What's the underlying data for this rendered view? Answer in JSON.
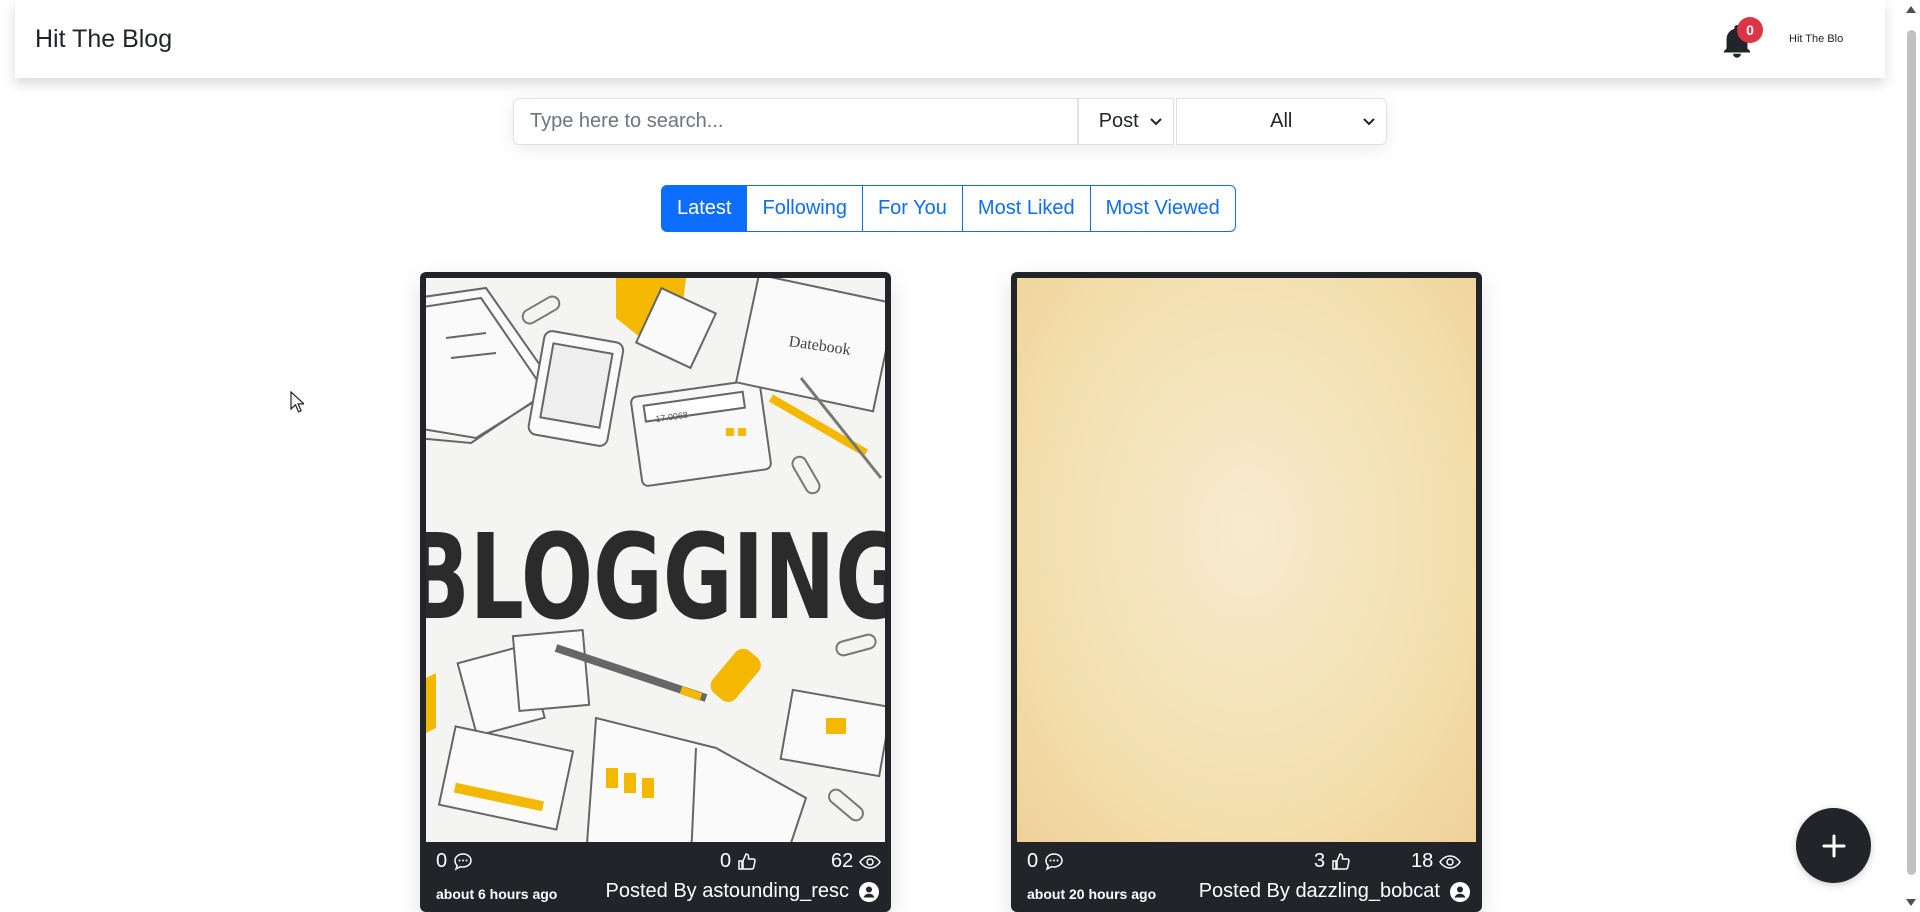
{
  "header": {
    "brand": "Hit The Blog",
    "notification_count": "0",
    "profile_label": "Hit The Blo"
  },
  "search": {
    "placeholder": "Type here to search...",
    "type_value": "Post",
    "filter_value": "All"
  },
  "tabs": [
    {
      "label": "Latest",
      "active": true
    },
    {
      "label": "Following",
      "active": false
    },
    {
      "label": "For You",
      "active": false
    },
    {
      "label": "Most Liked",
      "active": false
    },
    {
      "label": "Most Viewed",
      "active": false
    }
  ],
  "posts": [
    {
      "image_text": "BLOGGING",
      "image_note": "Datebook",
      "image_calc": "17.0068",
      "comments": "0",
      "likes": "0",
      "views": "62",
      "time": "about 6 hours ago",
      "author": "Posted By astounding_resc"
    },
    {
      "comments": "0",
      "likes": "3",
      "views": "18",
      "time": "about 20 hours ago",
      "author": "Posted By dazzling_bobcat"
    }
  ],
  "colors": {
    "primary": "#0d6efd",
    "dark": "#212529",
    "badge": "#dc3545",
    "accent_yellow": "#f5b800"
  },
  "icons": [
    "bell-icon",
    "chevron-down-icon",
    "comment-icon",
    "like-icon",
    "eye-icon",
    "user-icon",
    "plus-icon"
  ]
}
